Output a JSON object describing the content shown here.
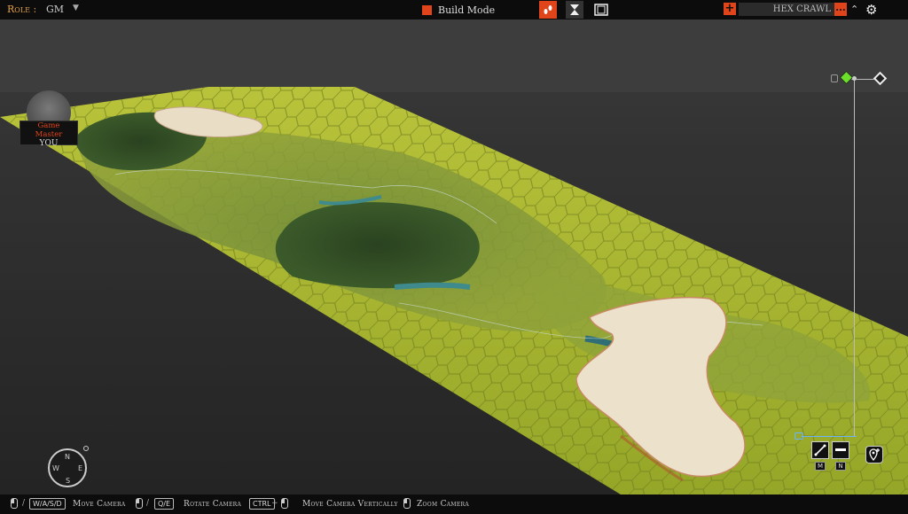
{
  "topbar": {
    "role_label": "Role :",
    "role_value": "GM",
    "role_caret": "▼",
    "build_mode_label": "Build Mode",
    "campaign_name": "HEX CRAWL",
    "dots_label": "...",
    "plus_label": "+",
    "collapse_icon": "chevron-up-icon",
    "settings_icon": "gear-icon"
  },
  "gm_badge": {
    "title_line1": "Game",
    "title_line2": "Master",
    "player": "YOU"
  },
  "compass": {
    "n": "N",
    "s": "S",
    "e": "E",
    "w": "W"
  },
  "tools": {
    "line_key": "M",
    "remove_key": "N"
  },
  "controls": {
    "move_keys": "W/A/S/D",
    "move_label": "Move Camera",
    "rotate_keys": "Q/E",
    "rotate_label": "Rotate Camera",
    "vertical_key": "CTRL",
    "vertical_plus": "+",
    "vertical_label": "Move Camera Vertically",
    "zoom_label": "Zoom Camera",
    "separator": "/"
  },
  "colors": {
    "accent": "#e0441b",
    "terrain_grass": "#a6b531",
    "terrain_forest": "#2f4a25",
    "terrain_mountain": "#e9ddc6",
    "water": "#3e8a8c"
  }
}
